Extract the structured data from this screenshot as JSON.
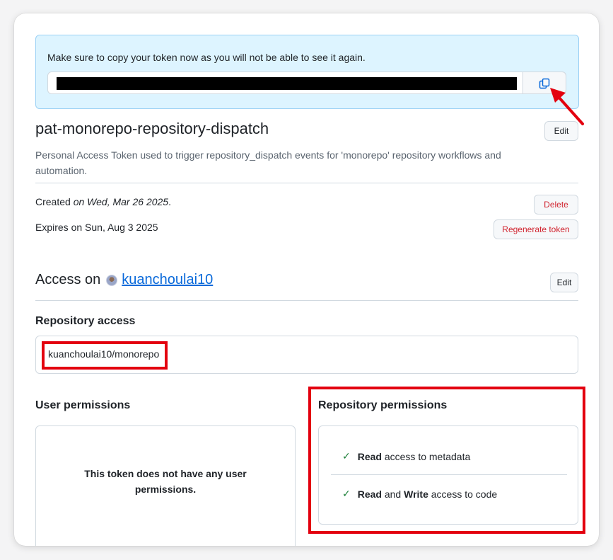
{
  "flash": {
    "message": "Make sure to copy your token now as you will not be able to see it again."
  },
  "token": {
    "name": "pat-monorepo-repository-dispatch",
    "edit_label": "Edit",
    "description": "Personal Access Token used to trigger repository_dispatch events for 'monorepo' repository workflows and automation.",
    "created_prefix": "Created",
    "created_date": "on Wed, Mar 26 2025",
    "created_suffix": ".",
    "expires": "Expires on Sun, Aug 3 2025",
    "delete_label": "Delete",
    "regenerate_label": "Regenerate token"
  },
  "access": {
    "title_prefix": "Access on",
    "user": "kuanchoulai10",
    "edit_label": "Edit"
  },
  "repository_access": {
    "heading": "Repository access",
    "repo": "kuanchoulai10/monorepo"
  },
  "user_permissions": {
    "heading": "User permissions",
    "empty_line1": "This token does not have any user",
    "empty_line2": "permissions."
  },
  "repository_permissions": {
    "heading": "Repository permissions",
    "items": [
      {
        "pre": "Read",
        "mid": " access to metadata",
        "bold2": "",
        "post": ""
      },
      {
        "pre": "Read",
        "mid": " and ",
        "bold2": "Write",
        "post": " access to code"
      }
    ]
  },
  "colors": {
    "annotation": "#e3000f",
    "link": "#0969da",
    "danger": "#d1242f",
    "success": "#1a7f37",
    "flash_bg": "#ddf4ff"
  },
  "icons": {
    "copy": "copy-icon",
    "check": "check-icon",
    "arrow": "annotation-arrow"
  }
}
